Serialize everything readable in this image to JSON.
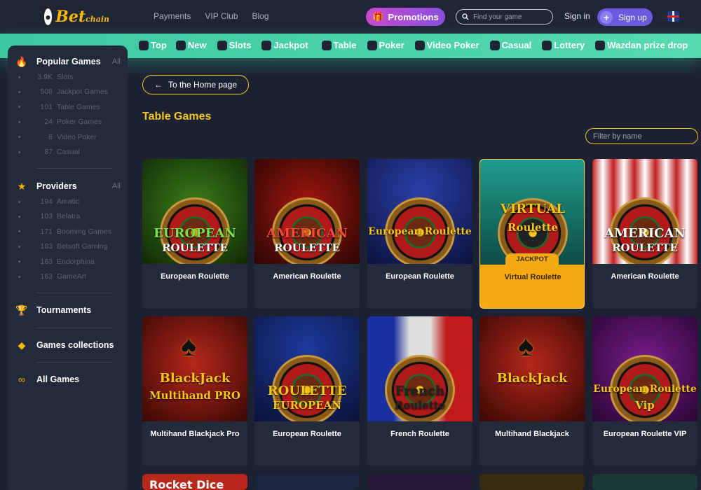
{
  "topbar": {
    "logo_text": "Bet",
    "logo_sub": "chain",
    "nav": [
      "Payments",
      "VIP Club",
      "Blog"
    ],
    "promotions": "Promotions",
    "search_placeholder": "Find your game",
    "signin": "Sign in",
    "signup": "Sign up"
  },
  "categories": [
    {
      "label": "Top",
      "icon": "thumb-icon"
    },
    {
      "label": "New",
      "icon": "badge-icon"
    },
    {
      "label": "Slots",
      "icon": "slot-icon"
    },
    {
      "label": "Jackpot",
      "icon": "jackpot-icon"
    },
    {
      "label": "Table",
      "icon": "dice-icon"
    },
    {
      "label": "Poker",
      "icon": "spade-icon"
    },
    {
      "label": "Video Poker",
      "icon": "chips-icon"
    },
    {
      "label": "Casual",
      "icon": "pacman-icon"
    },
    {
      "label": "Lottery",
      "icon": "ticket-icon"
    },
    {
      "label": "Wazdan prize drop",
      "icon": "drop-icon"
    }
  ],
  "sidebar": {
    "popular": {
      "title": "Popular Games",
      "all": "All",
      "items": [
        {
          "count": "3.9K",
          "label": "Slots"
        },
        {
          "count": "508",
          "label": "Jackpot Games"
        },
        {
          "count": "101",
          "label": "Table Games"
        },
        {
          "count": "24",
          "label": "Poker Games"
        },
        {
          "count": "8",
          "label": "Video Poker"
        },
        {
          "count": "87",
          "label": "Casual"
        }
      ]
    },
    "providers": {
      "title": "Providers",
      "all": "All",
      "items": [
        {
          "count": "194",
          "label": "Amatic"
        },
        {
          "count": "103",
          "label": "Belatra"
        },
        {
          "count": "171",
          "label": "Booming Games"
        },
        {
          "count": "183",
          "label": "Betsoft Gaming"
        },
        {
          "count": "163",
          "label": "Endorphina"
        },
        {
          "count": "163",
          "label": "GameArt"
        }
      ]
    },
    "tournaments": "Tournaments",
    "collections": "Games collections",
    "all_games": "All Games"
  },
  "main": {
    "back_label": "To the Home page",
    "title": "Table Games",
    "filter_placeholder": "Filter by name",
    "jackpot_badge": "JACKPOT",
    "games": [
      {
        "name": "European Roulette",
        "art1": "EUROPEAN",
        "art2": "ROULETTE"
      },
      {
        "name": "American Roulette",
        "art1": "AMERICAN",
        "art2": "ROULETTE"
      },
      {
        "name": "European Roulette",
        "art1": "European Roulette",
        "art2": ""
      },
      {
        "name": "Virtual Roulette",
        "art1": "VIRTUAL",
        "art2": "Roulette"
      },
      {
        "name": "American Roulette",
        "art1": "AMERICAN",
        "art2": "ROULETTE"
      },
      {
        "name": "Multihand Blackjack Pro",
        "art1": "BlackJack",
        "art2": "Multihand PRO"
      },
      {
        "name": "European Roulette",
        "art1": "ROULETTE",
        "art2": "EUROPEAN"
      },
      {
        "name": "French Roulette",
        "art1": "French",
        "art2": "Roulette"
      },
      {
        "name": "Multihand Blackjack",
        "art1": "BlackJack",
        "art2": ""
      },
      {
        "name": "European Roulette VIP",
        "art1": "European Roulette",
        "art2": "Vip"
      }
    ],
    "partial_art": "Rocket Dice"
  },
  "colors": {
    "bg": "#1c2231",
    "accent_green": "#3cc9a2",
    "accent_yellow": "#f5c518",
    "promo": "#c64bd0",
    "signup": "#6a5ae0"
  }
}
